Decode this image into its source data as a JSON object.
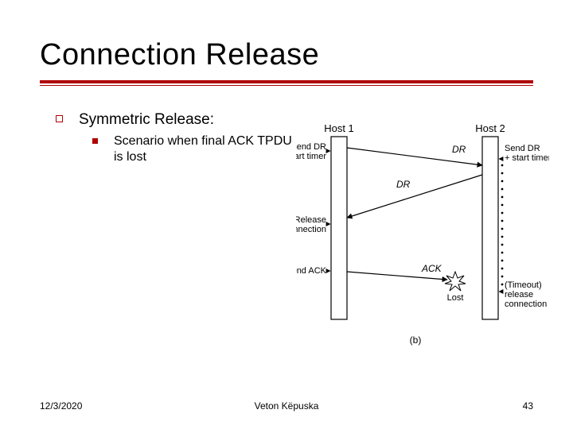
{
  "title": "Connection Release",
  "bullets": {
    "lvl1": "Symmetric Release:",
    "lvl2": "Scenario when final ACK TPDU is lost"
  },
  "diagram": {
    "host1": "Host 1",
    "host2": "Host 2",
    "sendDR": "Send DR\n+ start timer",
    "release": "Release\nconnection",
    "sendACK": "Send ACK",
    "timeout": "(Timeout)\nrelease\nconnection",
    "msgDR1": "DR",
    "msgDR2": "DR",
    "msgACK": "ACK",
    "lost": "Lost",
    "sublabel": "(b)"
  },
  "footer": {
    "date": "12/3/2020",
    "author": "Veton Këpuska",
    "page": "43"
  }
}
